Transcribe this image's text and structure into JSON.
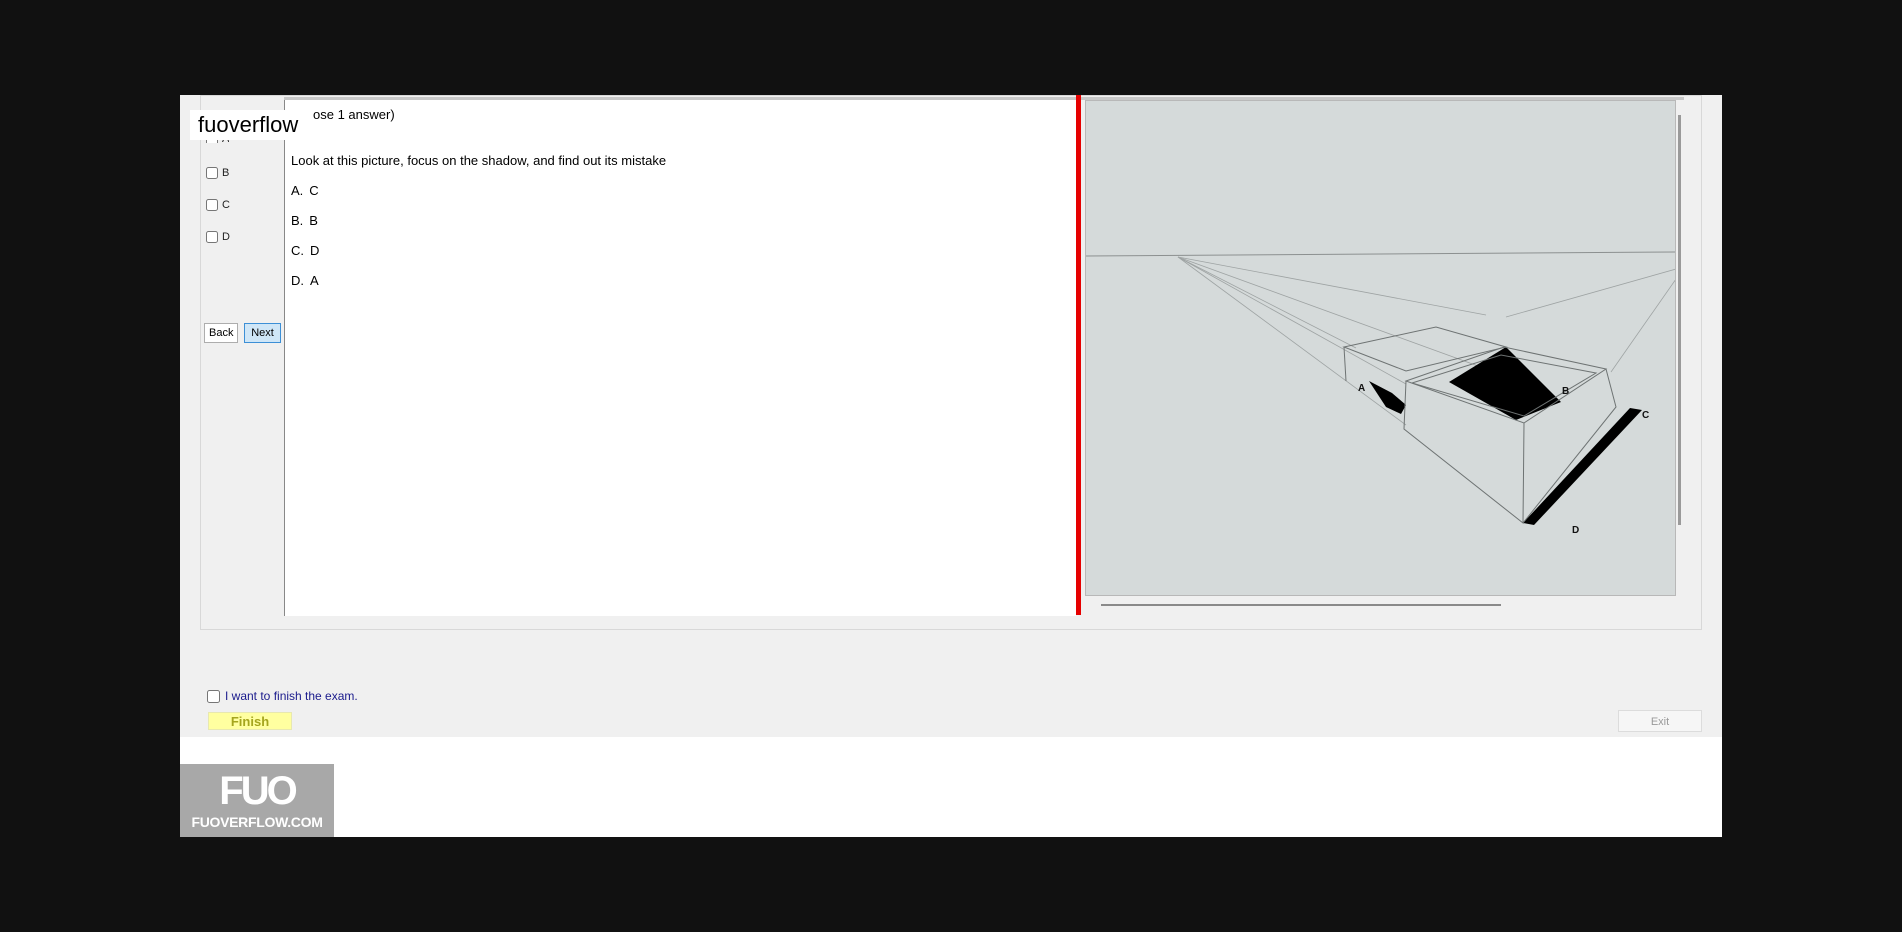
{
  "question": {
    "header": "ose 1 answer)",
    "text": "Look at this picture, focus on the shadow, and find out its mistake",
    "answers": [
      {
        "key": "A.",
        "value": "C"
      },
      {
        "key": "B.",
        "value": "B"
      },
      {
        "key": "C.",
        "value": "D"
      },
      {
        "key": "D.",
        "value": "A"
      }
    ]
  },
  "options": {
    "partial_label": "A",
    "items": [
      "B",
      "C",
      "D"
    ]
  },
  "nav": {
    "back_label": "Back",
    "next_label": "Next"
  },
  "watermark": "fuoverflow",
  "figure": {
    "labels": [
      "A",
      "B",
      "C",
      "D"
    ]
  },
  "finish": {
    "checkbox_label": "I want to finish the exam.",
    "button_label": "Finish"
  },
  "exit_label": "Exit",
  "logo": {
    "mark": "FUO",
    "site": "FUOVERFLOW.COM"
  },
  "colors": {
    "splitter": "#e60000",
    "finish_bg": "#ffffa0",
    "next_bg": "#cfe6f7",
    "checkbox_text": "#1a1a8c"
  }
}
